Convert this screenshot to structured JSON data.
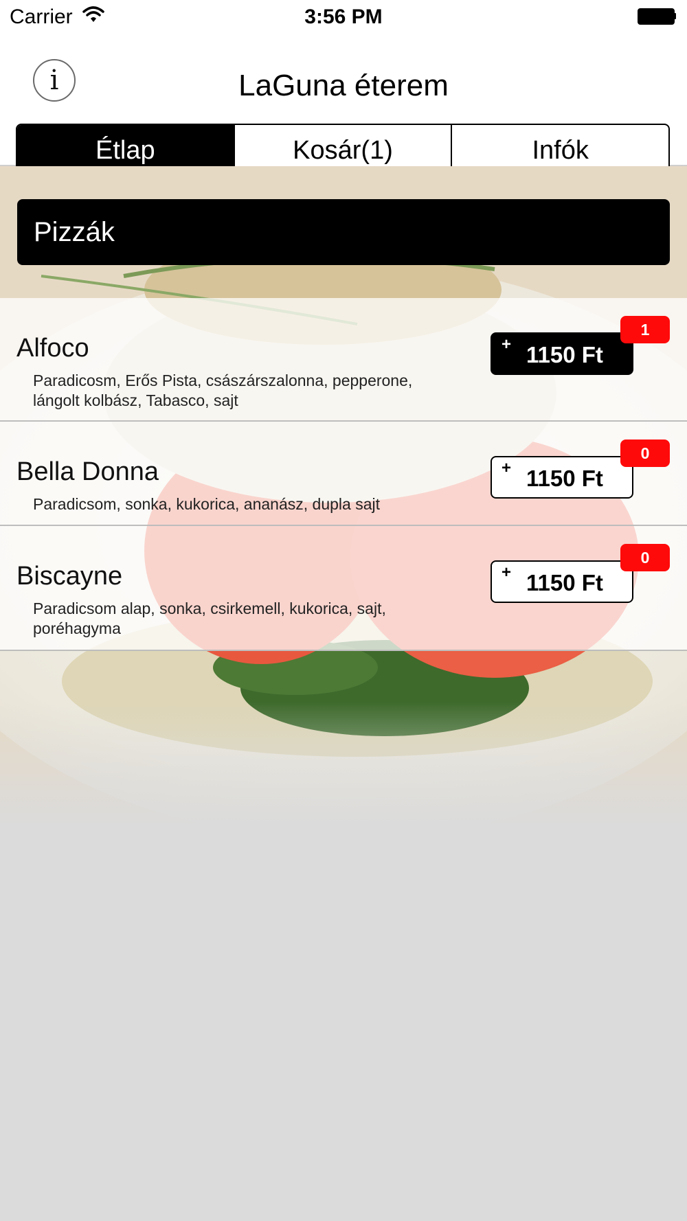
{
  "status_bar": {
    "carrier": "Carrier",
    "time": "3:56 PM"
  },
  "header": {
    "title": "LaGuna éterem",
    "info_glyph": "i"
  },
  "tabs": [
    {
      "label": "Étlap",
      "active": true
    },
    {
      "label": "Kosár(1)",
      "active": false
    },
    {
      "label": "Infók",
      "active": false
    }
  ],
  "category": {
    "label": "Pizzák"
  },
  "items": [
    {
      "name": "Alfoco",
      "description": "Paradicosm, Erős Pista, császárszalonna, pepperone, lángolt kolbász, Tabasco, sajt",
      "plus": "+",
      "price": "1150 Ft",
      "count": "1",
      "in_cart": true
    },
    {
      "name": "Bella Donna",
      "description": "Paradicsom, sonka, kukorica, ananász, dupla sajt",
      "plus": "+",
      "price": "1150 Ft",
      "count": "0",
      "in_cart": false
    },
    {
      "name": "Biscayne",
      "description": "Paradicsom alap, sonka, csirkemell, kukorica, sajt, poréhagyma",
      "plus": "+",
      "price": "1150 Ft",
      "count": "0",
      "in_cart": false
    }
  ],
  "colors": {
    "badge": "#ff0a0a",
    "active_segment": "#000000",
    "background": "#dbdbdb"
  },
  "icons": {
    "info": "info-icon",
    "wifi": "wifi-icon",
    "battery": "battery-icon"
  }
}
